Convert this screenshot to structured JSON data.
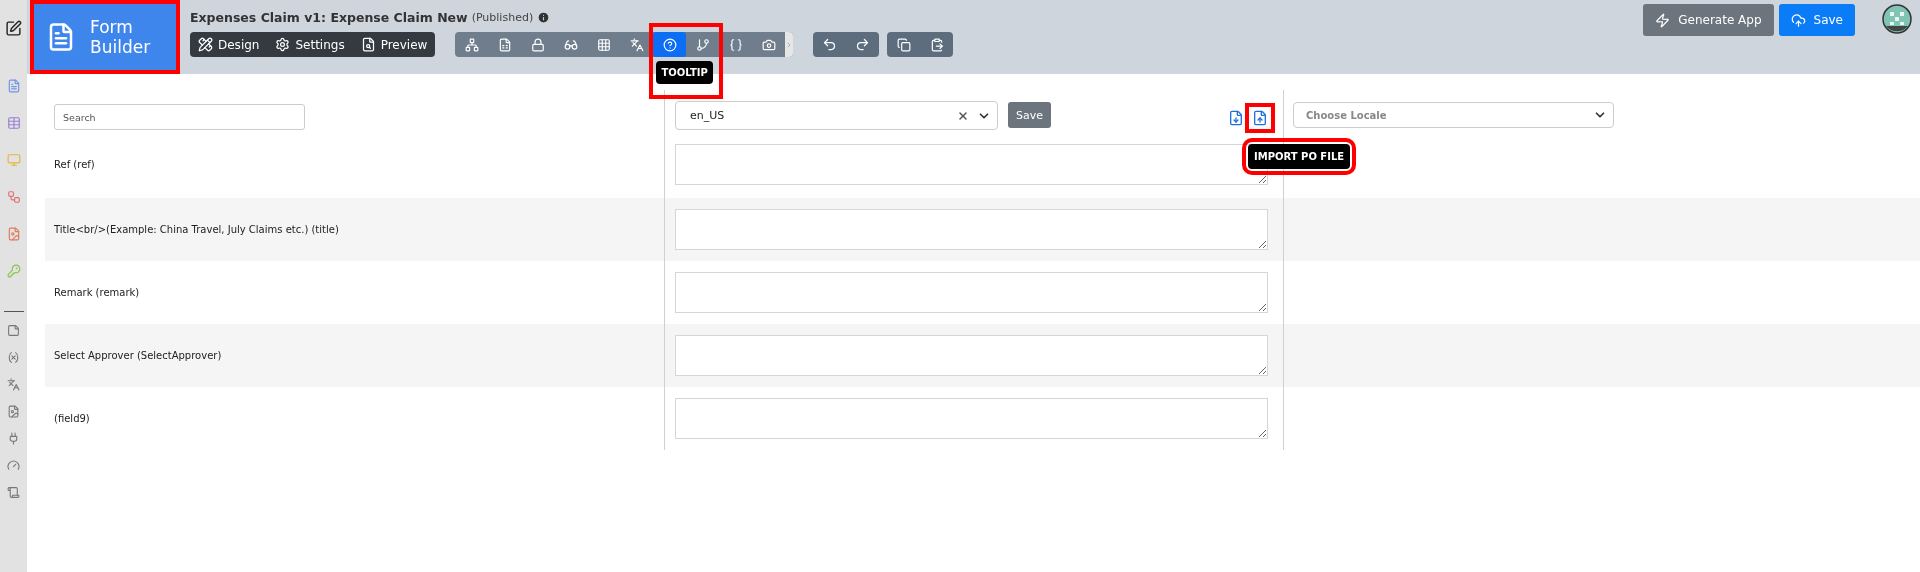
{
  "logo": {
    "title": "Form Builder"
  },
  "header": {
    "title": "Expenses Claim v1: Expense Claim New",
    "status": "(Published)"
  },
  "mode_tabs": [
    {
      "label": "Design",
      "kind": "design"
    },
    {
      "label": "Settings",
      "kind": "settings"
    },
    {
      "label": "Preview",
      "kind": "preview"
    }
  ],
  "tools": [
    {
      "kind": "hierarchy",
      "selected": false
    },
    {
      "kind": "form",
      "selected": false
    },
    {
      "kind": "lock",
      "selected": false
    },
    {
      "kind": "glasses",
      "selected": false
    },
    {
      "kind": "grid",
      "selected": false
    },
    {
      "kind": "translate",
      "selected": false
    },
    {
      "kind": "help",
      "selected": true,
      "tooltip": "TOOLTIP"
    },
    {
      "kind": "branch",
      "selected": false
    },
    {
      "kind": "code",
      "selected": false
    },
    {
      "kind": "camera",
      "selected": false
    }
  ],
  "actions": [
    {
      "label": "Generate App",
      "kind": "generate"
    },
    {
      "label": "Save",
      "kind": "save"
    }
  ],
  "search": {
    "placeholder": "Search"
  },
  "locale": {
    "value": "en_US",
    "save": "Save",
    "import_tooltip": "IMPORT PO FILE"
  },
  "target_locale": {
    "placeholder": "Choose Locale"
  },
  "fields": [
    {
      "label": "Ref (ref)"
    },
    {
      "label": "Title<br/>(Example: China Travel, July Claims etc.) (title)"
    },
    {
      "label": "Remark (remark)"
    },
    {
      "label": "Select Approver (SelectApprover)"
    },
    {
      "label": "(field9)"
    }
  ]
}
